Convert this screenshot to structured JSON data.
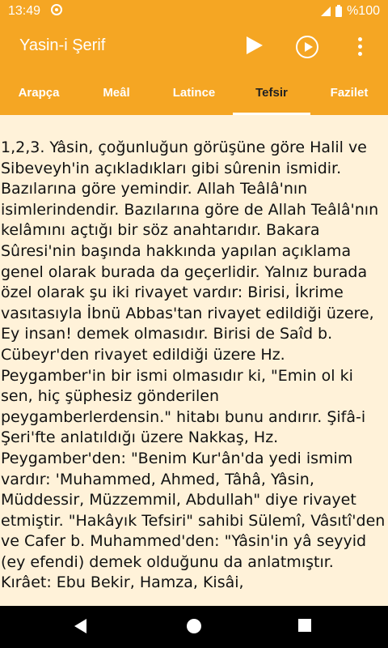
{
  "status_bar": {
    "time": "13:49",
    "battery": "%100"
  },
  "app_bar": {
    "title": "Yasin-i Şerif"
  },
  "tabs": [
    {
      "label": "Arapça"
    },
    {
      "label": "Meâl"
    },
    {
      "label": "Latince"
    },
    {
      "label": "Tefsir",
      "active": true
    },
    {
      "label": "Fazilet"
    }
  ],
  "content": {
    "text": "1,2,3. Yâsin, çoğunluğun görüşüne göre Halil ve Sibeveyh'in açıkladıkları gibi sûrenin ismidir. Bazılarına göre yemindir. Allah Teâlâ'nın isimlerindendir. Bazılarına göre de Allah Teâlâ'nın kelâmını açtığı bir söz anahtarıdır. Bakara Sûresi'nin başında hakkında yapılan açıklama genel olarak burada da geçerlidir. Yalnız burada özel olarak şu iki rivayet vardır: Birisi, İkrime vasıtasıyla İbnü Abbas'tan rivayet edildiği üzere, Ey insan! demek olmasıdır. Birisi de Saîd b. Cübeyr'den rivayet edildiği üzere Hz. Peygamber'in bir ismi olmasıdır ki, \"Emin ol ki sen, hiç şüphesiz gönderilen peygamberlerdensin.\" hitabı bunu andırır. Şifâ-i Şeri'fte anlatıldığı üzere Nakkaş, Hz. Peygamber'den: \"Benim Kur'ân'da yedi ismim vardır: 'Muhammed, Ahmed, Tâhâ, Yâsin, Müddessir, Müzzemmil, Abdullah\" diye rivayet etmiştir. \"Hakâyık Tefsiri\" sahibi Sülemî, Vâsıtî'den ve Cafer b. Muhammed'den: \"Yâsin'in yâ seyyid (ey efendi) demek olduğunu da anlatmıştır. Kırâet: Ebu Bekir, Hamza, Kisâi,"
  },
  "colors": {
    "accent": "#f5a623",
    "background": "#fff2d9"
  }
}
